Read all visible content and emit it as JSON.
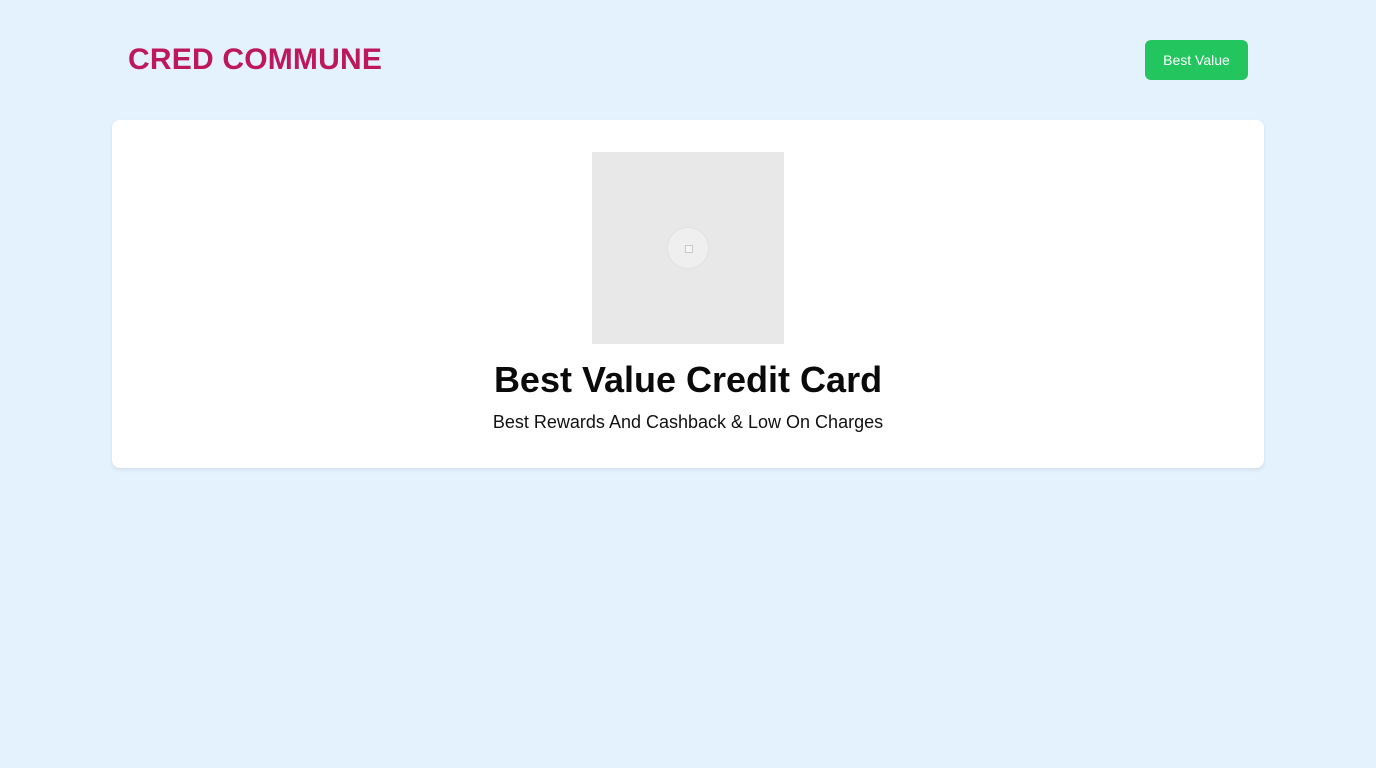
{
  "header": {
    "logo": "CRED COMMUNE",
    "nav_button_label": "Best Value"
  },
  "card": {
    "image_icon": "image-icon",
    "title": "Best Value Credit Card",
    "subtitle": "Best Rewards And Cashback & Low On Charges"
  },
  "colors": {
    "background": "#e4f2fe",
    "logo": "#be185d",
    "button": "#22c55e",
    "card": "#ffffff"
  }
}
